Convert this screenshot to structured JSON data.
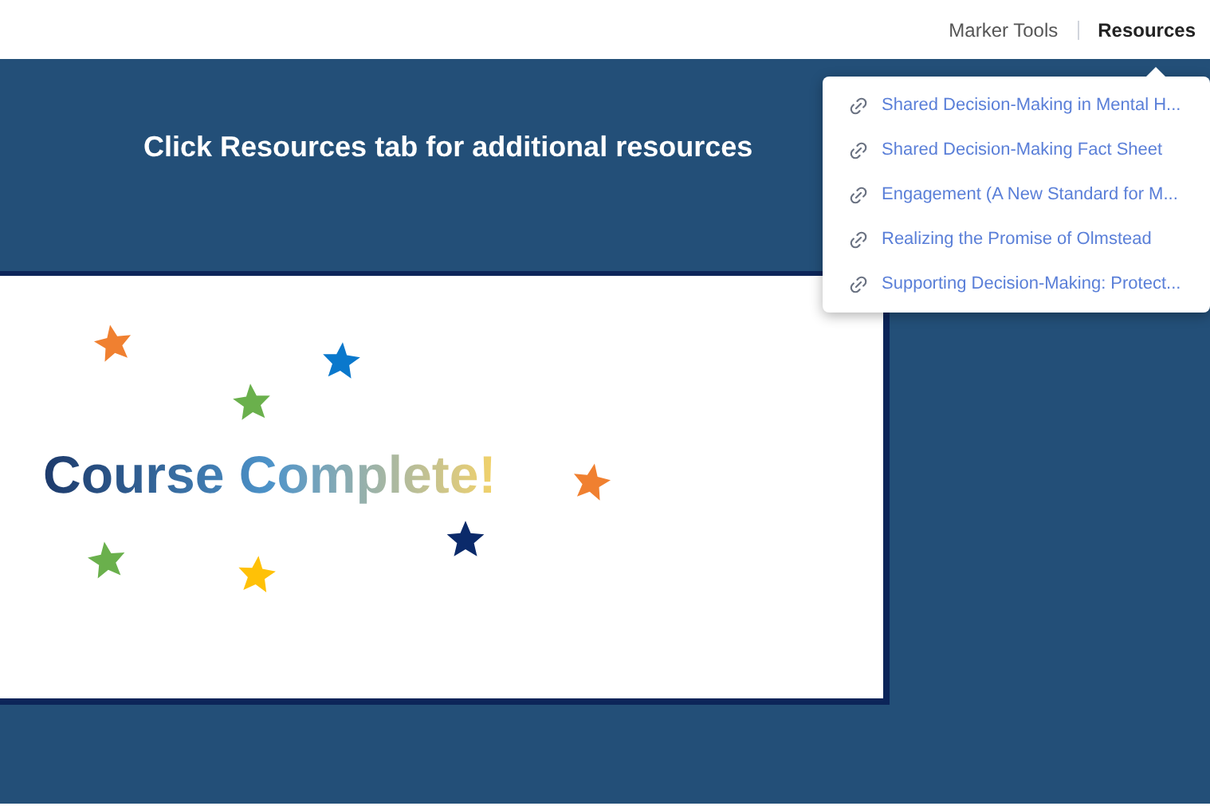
{
  "top_nav": {
    "items": [
      {
        "label": "Marker Tools",
        "selected": false
      },
      {
        "label": "Resources",
        "selected": true
      }
    ]
  },
  "banner": {
    "text": "Click Resources tab for additional resources"
  },
  "card": {
    "title": "Course Complete!"
  },
  "resources_menu": {
    "items": [
      {
        "label": "Shared Decision-Making in Mental H..."
      },
      {
        "label": "Shared Decision-Making Fact Sheet"
      },
      {
        "label": "Engagement (A New Standard for M..."
      },
      {
        "label": "Realizing the Promise of Olmstead"
      },
      {
        "label": "Supporting Decision-Making: Protect..."
      }
    ]
  }
}
